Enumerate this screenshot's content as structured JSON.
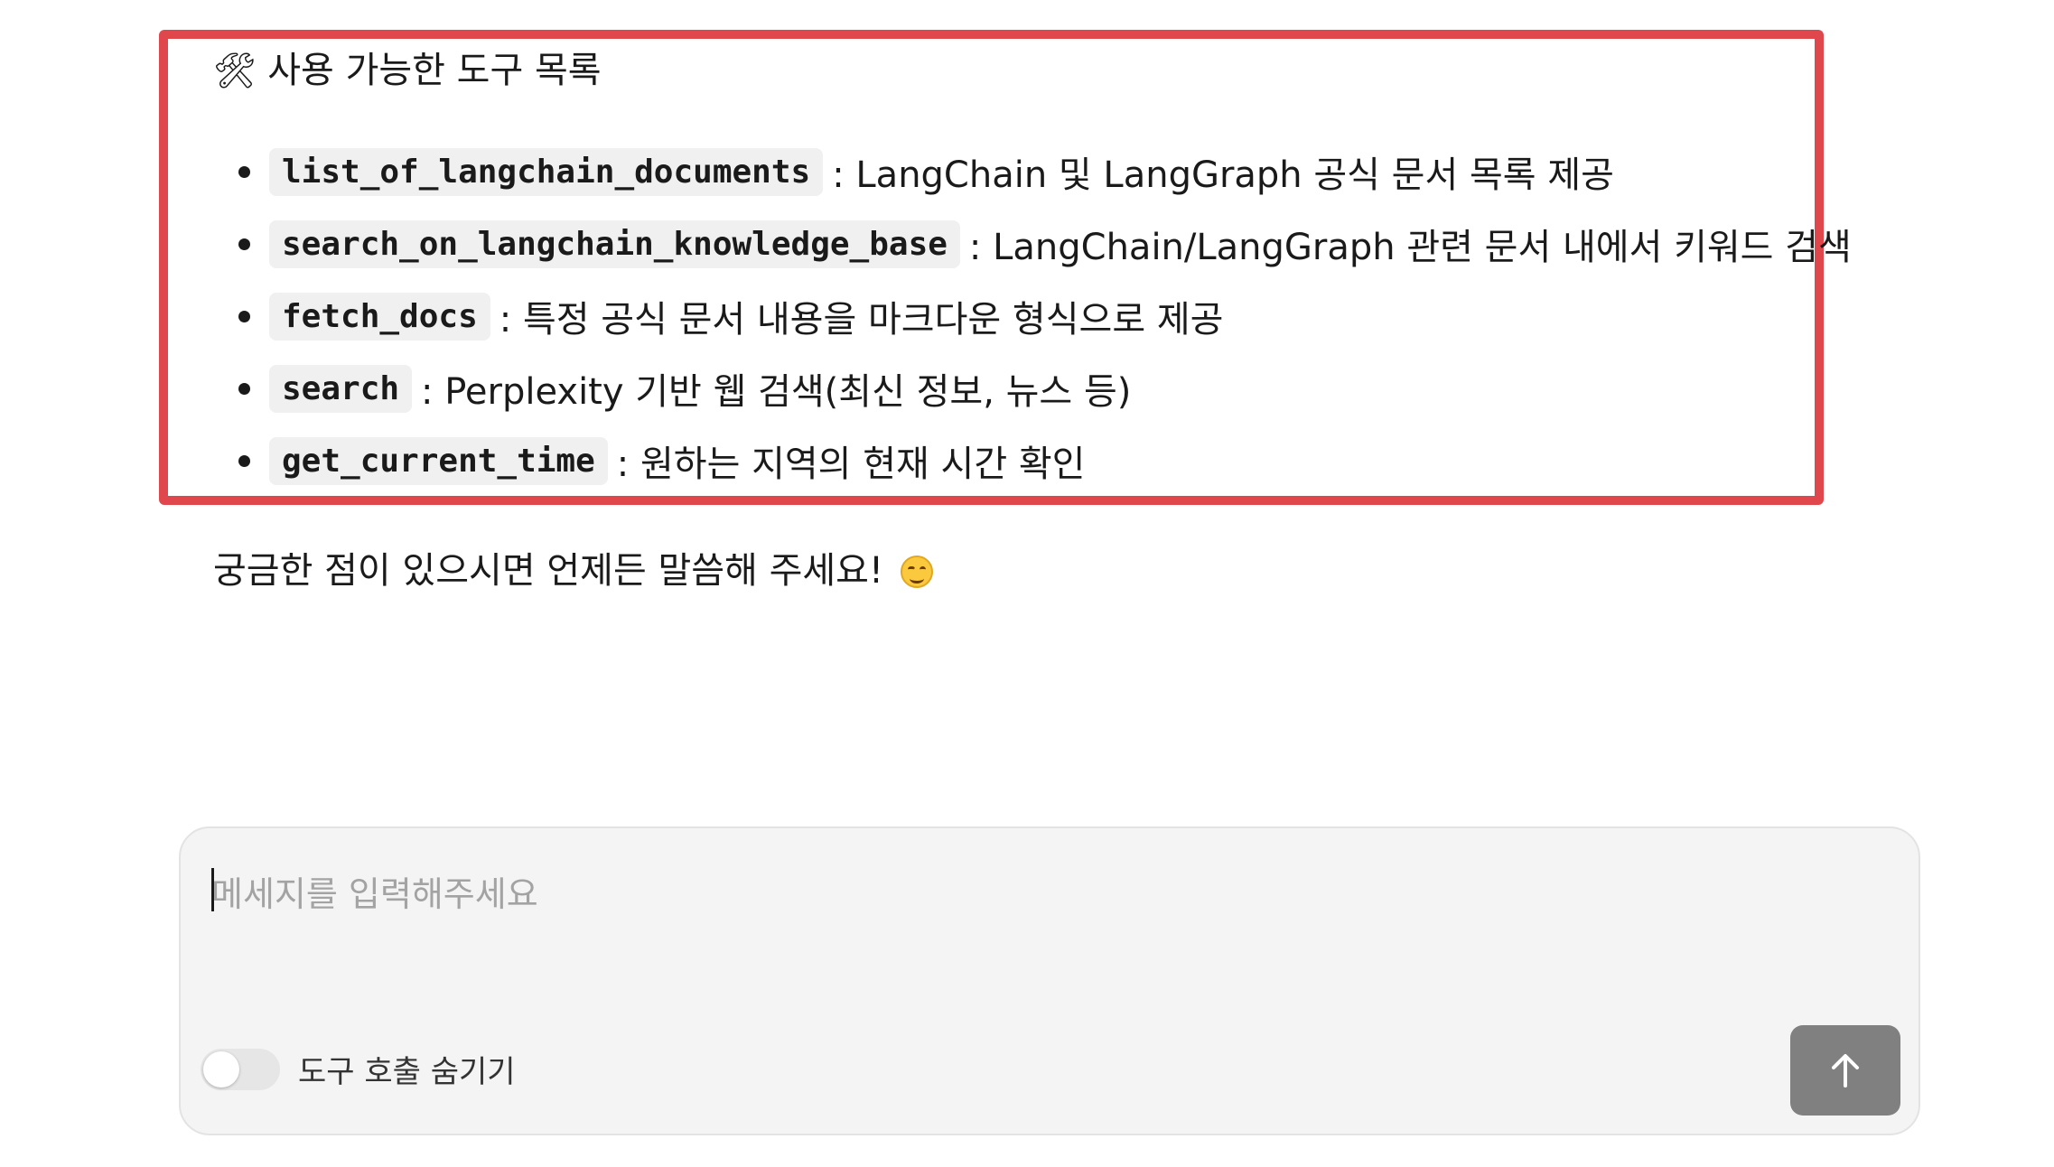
{
  "message": {
    "heading_emoji": "🛠",
    "heading": "사용 가능한 도구 목록",
    "tools": [
      {
        "name": "list_of_langchain_documents",
        "description": ": LangChain 및 LangGraph 공식 문서 목록 제공"
      },
      {
        "name": "search_on_langchain_knowledge_base",
        "description": ": LangChain/LangGraph 관련 문서 내에서 키워드 검색"
      },
      {
        "name": "fetch_docs",
        "description": ": 특정 공식 문서 내용을 마크다운 형식으로 제공"
      },
      {
        "name": "search",
        "description": ": Perplexity 기반 웹 검색(최신 정보, 뉴스 등)"
      },
      {
        "name": "get_current_time",
        "description": ": 원하는 지역의 현재 시간 확인"
      }
    ],
    "closing": "궁금한 점이 있으시면 언제든 말씀해 주세요!",
    "closing_icon": "smiling-face-icon"
  },
  "highlight_color": "#e0474c",
  "composer": {
    "placeholder": "메세지를 입력해주세요",
    "value": "",
    "toggle_label": "도구 호출 숨기기",
    "toggle_on": false,
    "send_icon": "arrow-up-icon",
    "send_color": "#808080"
  }
}
